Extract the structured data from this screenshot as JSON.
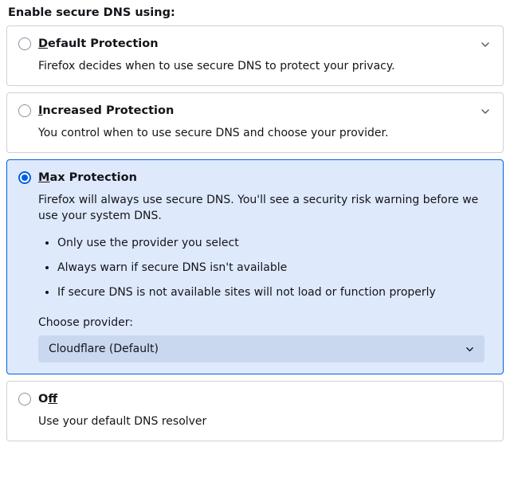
{
  "heading": "Enable secure DNS using:",
  "options": {
    "default": {
      "label_pre": "",
      "label_ak": "D",
      "label_post": "efault Protection",
      "desc": "Firefox decides when to use secure DNS to protect your privacy.",
      "has_chevron": true
    },
    "increased": {
      "label_pre": "",
      "label_ak": "I",
      "label_post": "ncreased Protection",
      "desc": "You control when to use secure DNS and choose your provider.",
      "has_chevron": true
    },
    "max": {
      "label_pre": "",
      "label_ak": "M",
      "label_post": "ax Protection",
      "desc": "Firefox will always use secure DNS. You'll see a security risk warning before we use your system DNS.",
      "bullets": [
        "Only use the provider you select",
        "Always warn if secure DNS isn't available",
        "If secure DNS is not available sites will not load or function properly"
      ],
      "provider_label": "Choose provider:",
      "provider_selected": "Cloudflare (Default)"
    },
    "off": {
      "label_pre": "O",
      "label_ak": "f",
      "label_post": "f",
      "desc": "Use your default DNS resolver"
    }
  },
  "selected": "max"
}
